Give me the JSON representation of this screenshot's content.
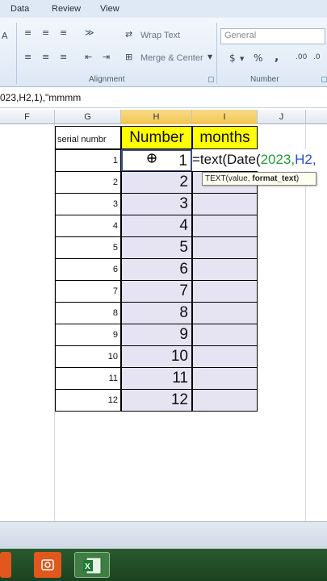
{
  "ribbon": {
    "tabs": [
      "Data",
      "Review",
      "View"
    ],
    "wrap_text": "Wrap Text",
    "merge_center": "Merge & Center",
    "number_format": "General",
    "currency": "$",
    "percent": "%",
    "comma": ",",
    "inc_decimal": ".00",
    "dec_decimal": ".0",
    "alignment_label": "Alignment",
    "number_label": "Number"
  },
  "formula_bar": {
    "text": "023,H2,1),\"mmmm"
  },
  "columns": [
    "F",
    "G",
    "H",
    "I",
    "J"
  ],
  "headers": {
    "serial": "serial numbr",
    "number": "Number",
    "months": "months"
  },
  "rows": [
    {
      "serial": "1",
      "number": "1"
    },
    {
      "serial": "2",
      "number": "2"
    },
    {
      "serial": "3",
      "number": "3"
    },
    {
      "serial": "4",
      "number": "4"
    },
    {
      "serial": "5",
      "number": "5"
    },
    {
      "serial": "6",
      "number": "6"
    },
    {
      "serial": "7",
      "number": "7"
    },
    {
      "serial": "8",
      "number": "8"
    },
    {
      "serial": "9",
      "number": "9"
    },
    {
      "serial": "10",
      "number": "10"
    },
    {
      "serial": "11",
      "number": "11"
    },
    {
      "serial": "12",
      "number": "12"
    }
  ],
  "editing": {
    "p1": "=text(Date(",
    "p2": "2023,",
    "p3": "H2,"
  },
  "tooltip": {
    "fn": "TEXT(value, ",
    "arg": "format_text",
    "close": ")"
  },
  "colors": {
    "header_yellow": "#ffff00",
    "number_fill": "#e6e4f2",
    "taskbar": "#1c4220"
  }
}
